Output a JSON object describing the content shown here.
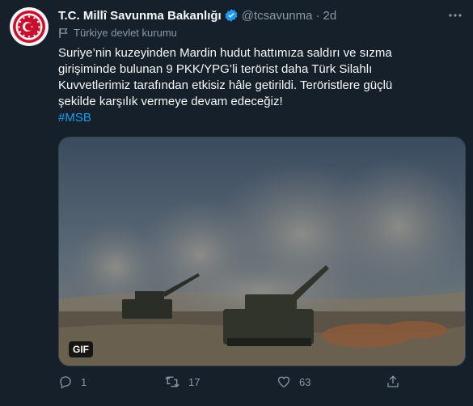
{
  "account": {
    "name": "T.C. Millî Savunma Bakanlığı",
    "handle": "@tcsavunma",
    "separator": "·",
    "time": "2d",
    "label": "Türkiye devlet kurumu"
  },
  "tweet": {
    "text": "Suriye’nin kuzeyinden Mardin hudut hattımıza saldırı ve sızma girişiminde bulunan 9 PKK/YPG’li terörist daha Türk Silahlı Kuvvetlerimiz tarafından etkisiz hâle getirildi. Teröristlere güçlü şekilde karşılık vermeye devam edeceğiz!",
    "hashtag": "#MSB",
    "media_badge": "GIF"
  },
  "actions": {
    "replies": "1",
    "retweets": "17",
    "likes": "63"
  },
  "colors": {
    "background": "#15202b",
    "text_primary": "#f7f9f9",
    "text_secondary": "#8b98a5",
    "accent": "#1d9bf0",
    "verified": "#1d9bf0",
    "seal_red": "#c8102e"
  },
  "icons": {
    "verified": "verified-badge-icon",
    "label": "flag-icon",
    "more": "more-icon",
    "reply": "reply-icon",
    "retweet": "retweet-icon",
    "like": "like-icon",
    "share": "share-icon"
  }
}
